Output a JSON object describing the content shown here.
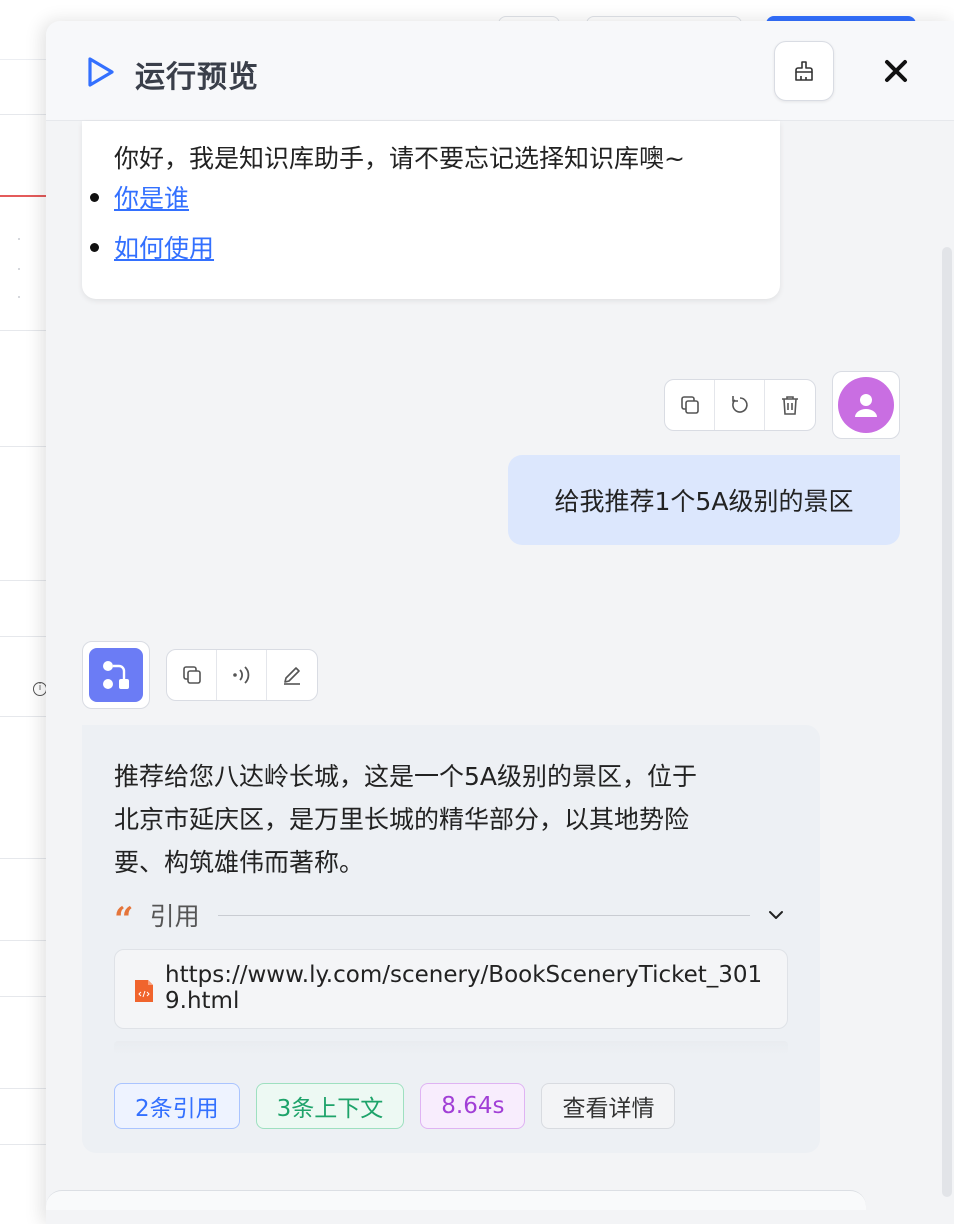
{
  "drawer": {
    "title": "运行预览",
    "close_icon": "close-icon",
    "clear_icon": "broom-icon",
    "play_icon": "play-icon"
  },
  "greeting": {
    "text": "你好，我是知识库助手，请不要忘记选择知识库噢~",
    "suggestions": [
      "你是谁",
      "如何使用"
    ]
  },
  "user_message": {
    "text": "给我推荐1个5A级别的景区",
    "actions": [
      "copy-icon",
      "retry-icon",
      "delete-icon"
    ],
    "avatar": "user-icon"
  },
  "bot_message": {
    "avatar": "workflow-icon",
    "actions": [
      "copy-icon",
      "speaker-icon",
      "edit-icon"
    ],
    "text_lines": [
      "推荐给您八达岭长城，这是一个5A级别的景区，位于",
      "北京市延庆区，是万里长城的精华部分，以其地势险",
      "要、构筑雄伟而著称。"
    ],
    "quote_mark": "“",
    "quote_label": "引用",
    "citation_url": "https://www.ly.com/scenery/BookSceneryTicket_3019.html",
    "tags": [
      "2条引用",
      "3条上下文",
      "8.64s",
      "查看详情"
    ]
  },
  "colors": {
    "accent": "#3370ff",
    "user_bubble": "#dce7fd",
    "user_avatar": "#c96ee2",
    "bot_avatar": "#6b7cf5"
  }
}
